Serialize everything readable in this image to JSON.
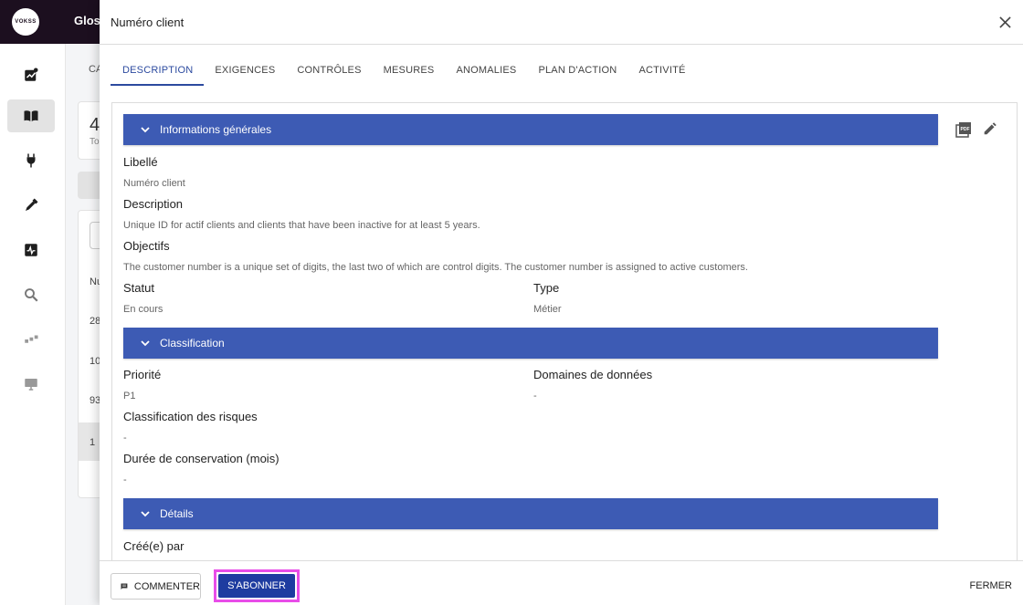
{
  "app": {
    "logo_text": "VOKSS",
    "title": "Glos",
    "breadcrumb": "CA",
    "card_value": "4",
    "card_label": "To",
    "table_header": "Nu",
    "table_rows": [
      "28",
      "10",
      "93",
      "1"
    ]
  },
  "sidebar": {
    "items": [
      {
        "icon": "trending-chart-icon"
      },
      {
        "icon": "book-open-icon"
      },
      {
        "icon": "plug-icon"
      },
      {
        "icon": "eyedropper-icon"
      },
      {
        "icon": "activity-box-icon"
      },
      {
        "icon": "search-icon"
      },
      {
        "icon": "dots-chart-icon"
      },
      {
        "icon": "monitor-icon"
      }
    ]
  },
  "drawer": {
    "title": "Numéro client",
    "tabs": [
      {
        "label": "DESCRIPTION"
      },
      {
        "label": "EXIGENCES"
      },
      {
        "label": "CONTRÔLES"
      },
      {
        "label": "MESURES"
      },
      {
        "label": "ANOMALIES"
      },
      {
        "label": "PLAN D'ACTION"
      },
      {
        "label": "ACTIVITÉ"
      }
    ],
    "sections": {
      "general": "Informations générales",
      "classification": "Classification",
      "details": "Détails"
    },
    "fields": {
      "libelle_label": "Libellé",
      "libelle_value": "Numéro client",
      "description_label": "Description",
      "description_value": "Unique ID for actif clients and clients that have been inactive for at least 5 years.",
      "objectifs_label": "Objectifs",
      "objectifs_value": "The customer number is a unique set of digits, the last two of which are control digits. The customer number is assigned to active customers.",
      "statut_label": "Statut",
      "statut_value": "En cours",
      "type_label": "Type",
      "type_value": "Métier",
      "priorite_label": "Priorité",
      "priorite_value": "P1",
      "domaines_label": "Domaines de données",
      "domaines_value": "-",
      "risques_label": "Classification des risques",
      "risques_value": "-",
      "duree_label": "Durée de conservation (mois)",
      "duree_value": "-",
      "cree_label": "Créé(e) par"
    },
    "footer": {
      "comment": "COMMENTER",
      "subscribe": "S'ABONNER",
      "close": "FERMER"
    }
  }
}
